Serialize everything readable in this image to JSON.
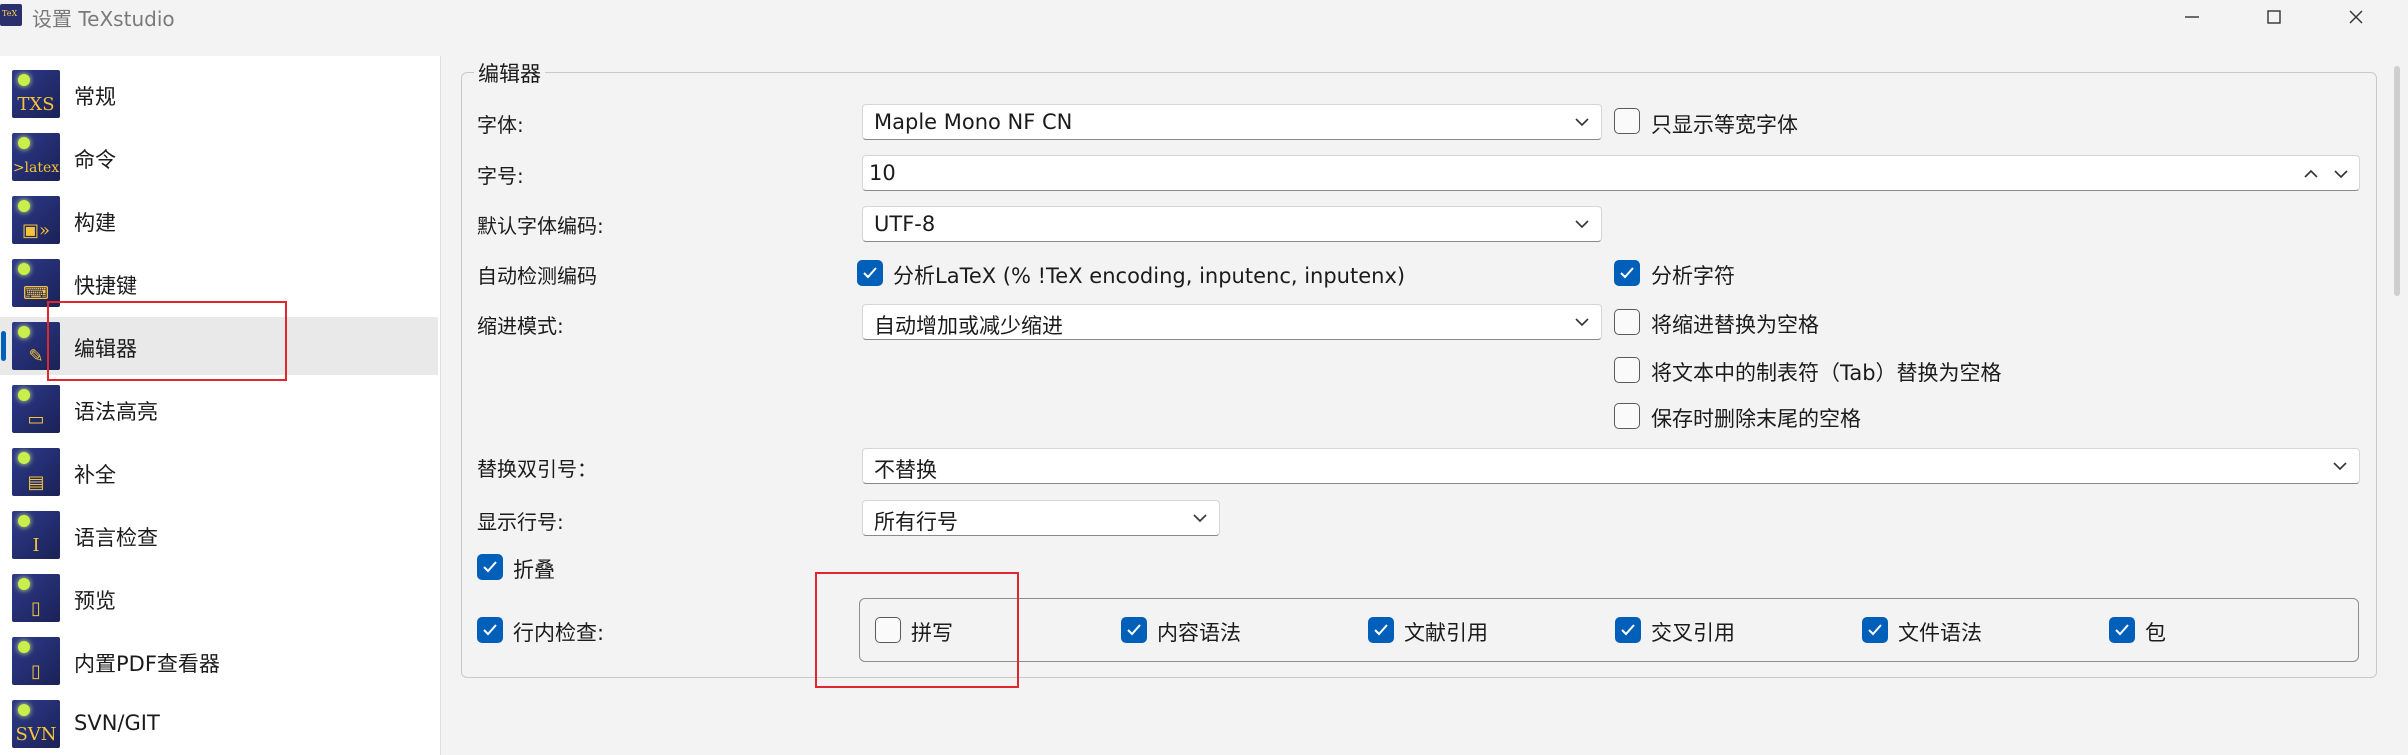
{
  "window": {
    "title": "设置 TeXstudio",
    "controls": [
      "minimize",
      "maximize",
      "close"
    ]
  },
  "sidebar": {
    "items": [
      {
        "label": "常规",
        "icon": "general-icon",
        "glyph": "TXS",
        "active": false
      },
      {
        "label": "命令",
        "icon": "latex-command-icon",
        "glyph": ">latex",
        "active": false
      },
      {
        "label": "构建",
        "icon": "build-icon",
        "glyph": "▣»",
        "active": false
      },
      {
        "label": "快捷键",
        "icon": "keyboard-icon",
        "glyph": "⌨",
        "active": false
      },
      {
        "label": "编辑器",
        "icon": "editor-icon",
        "glyph": "✎",
        "active": true
      },
      {
        "label": "语法高亮",
        "icon": "syntax-highlight-icon",
        "glyph": "▭",
        "active": false
      },
      {
        "label": "补全",
        "icon": "completion-icon",
        "glyph": "▤",
        "active": false
      },
      {
        "label": "语言检查",
        "icon": "language-check-icon",
        "glyph": "I",
        "active": false
      },
      {
        "label": "预览",
        "icon": "preview-icon",
        "glyph": "▯",
        "active": false
      },
      {
        "label": "内置PDF查看器",
        "icon": "pdf-viewer-icon",
        "glyph": "▯",
        "active": false
      },
      {
        "label": "SVN/GIT",
        "icon": "svn-git-icon",
        "glyph": "SVN",
        "active": false
      }
    ]
  },
  "editor": {
    "group_title": "编辑器",
    "font": {
      "label": "字体:",
      "value": "Maple Mono NF CN",
      "monospace_only": {
        "label": "只显示等宽字体",
        "checked": false
      }
    },
    "font_size": {
      "label": "字号:",
      "value": "10"
    },
    "default_encoding": {
      "label": "默认字体编码:",
      "value": "UTF-8"
    },
    "auto_detect": {
      "label": "自动检测编码",
      "analyze_latex": {
        "label": "分析LaTeX (% !TeX encoding, inputenc, inputenx)",
        "checked": true
      },
      "analyze_chars": {
        "label": "分析字符",
        "checked": true
      }
    },
    "indent_mode": {
      "label": "缩进模式:",
      "value": "自动增加或减少缩进",
      "replace_indent": {
        "label": "将缩进替换为空格",
        "checked": false
      },
      "replace_tab": {
        "label": "将文本中的制表符（Tab）替换为空格",
        "checked": false
      },
      "strip_trailing": {
        "label": "保存时删除末尾的空格",
        "checked": false
      }
    },
    "replace_quotes": {
      "label": "替换双引号：",
      "value": "不替换"
    },
    "line_numbers": {
      "label": "显示行号:",
      "value": "所有行号"
    },
    "folding": {
      "label": "折叠",
      "checked": true
    },
    "inline_check": {
      "label": "行内检查:",
      "checked": true,
      "options": [
        {
          "label": "拼写",
          "checked": false
        },
        {
          "label": "内容语法",
          "checked": true
        },
        {
          "label": "文献引用",
          "checked": true
        },
        {
          "label": "交叉引用",
          "checked": true
        },
        {
          "label": "文件语法",
          "checked": true
        },
        {
          "label": "包",
          "checked": true
        }
      ]
    }
  },
  "colors": {
    "accent": "#005fb8",
    "highlight": "#e0262f"
  }
}
